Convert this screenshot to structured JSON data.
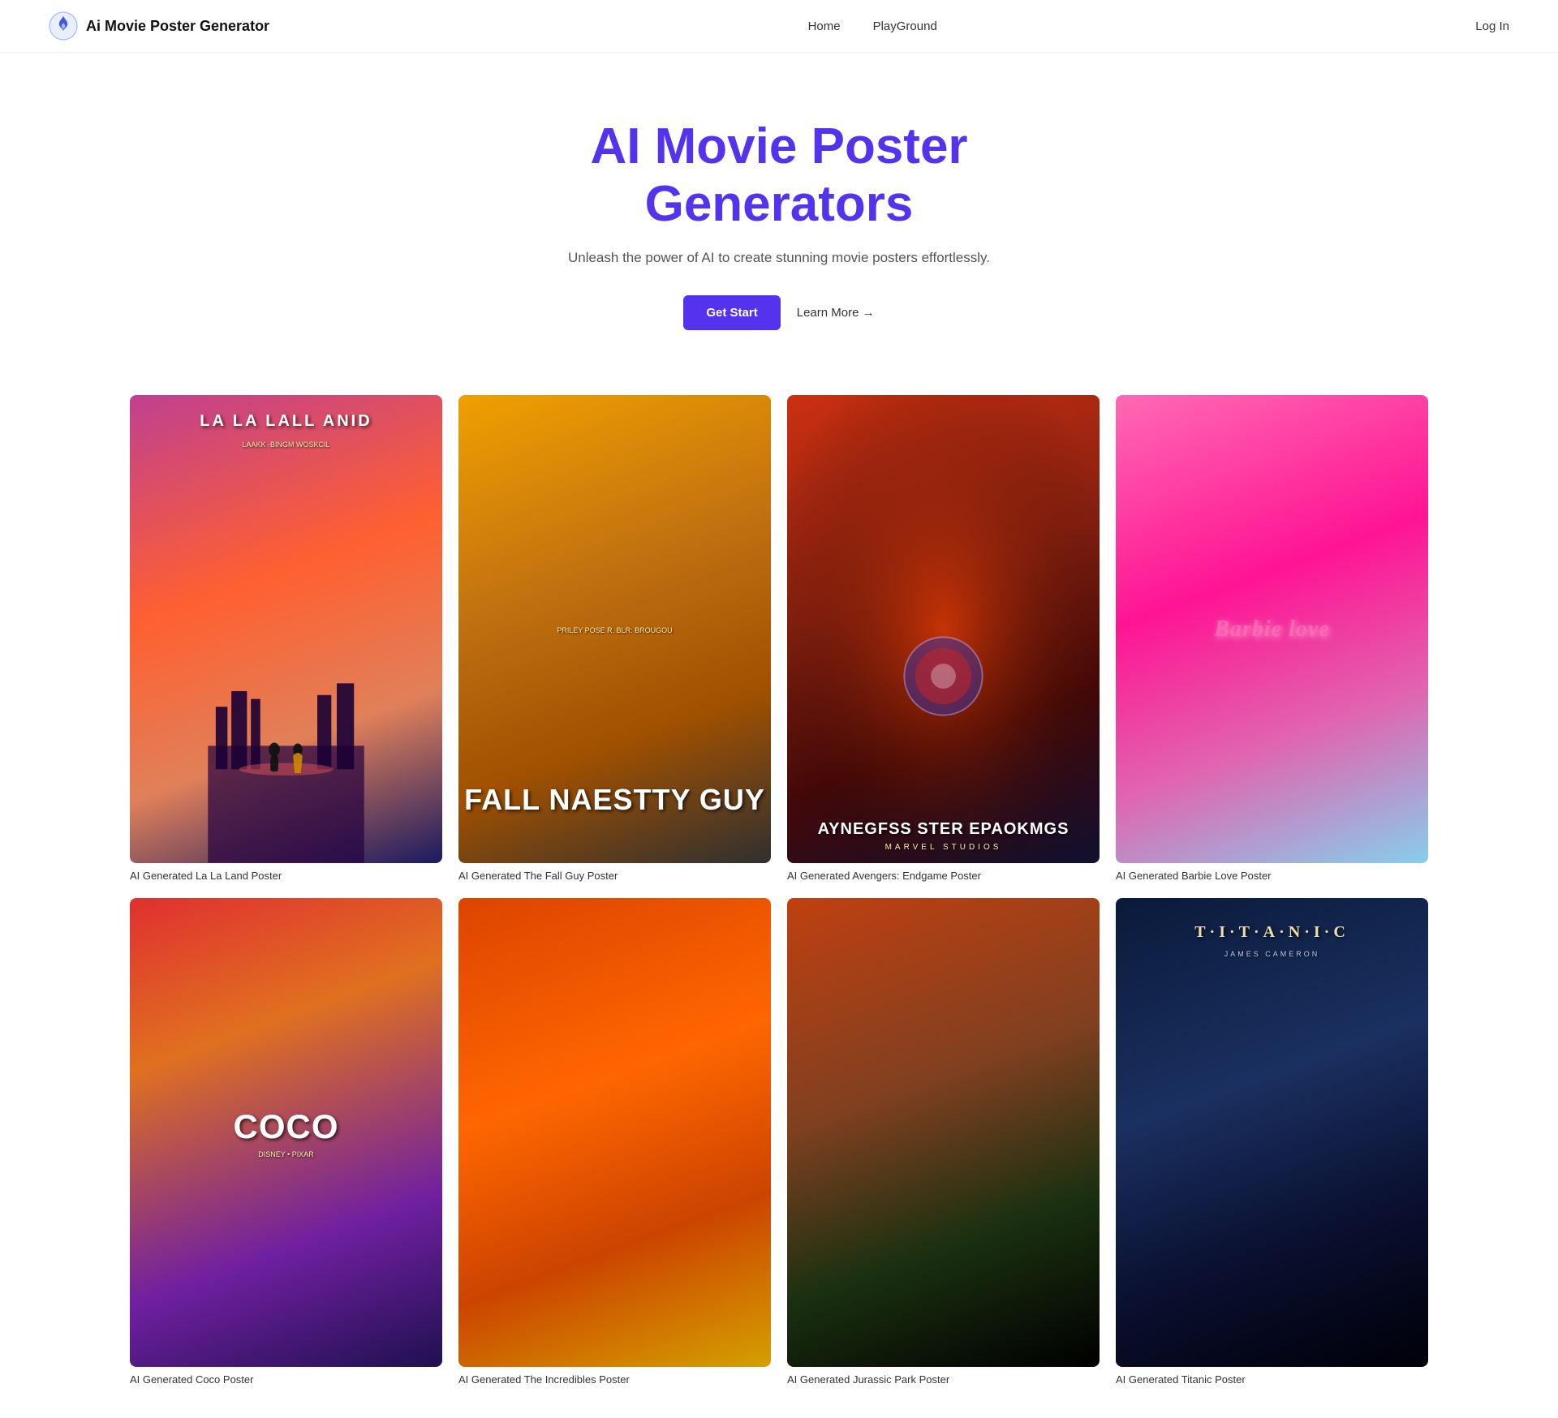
{
  "brand": {
    "name": "Ai Movie Poster Generator",
    "logo_alt": "flame-icon"
  },
  "nav": {
    "home": "Home",
    "playground": "PlayGround",
    "login": "Log In"
  },
  "hero": {
    "title_line1": "AI Movie Poster",
    "title_line2": "Generators",
    "subtitle": "Unleash the power of AI to create stunning movie posters effortlessly.",
    "cta_primary": "Get Start",
    "cta_secondary": "Learn More →"
  },
  "gallery": {
    "rows": [
      [
        {
          "id": "lalaland",
          "label": "AI Generated La La Land Poster",
          "title": "LA LA  LALL ANID",
          "subtitle": "LAAKK -BINGM WOSKCIL",
          "class": "poster-lalaland"
        },
        {
          "id": "fallguy",
          "label": "AI Generated The Fall Guy Poster",
          "title": "FALL\nNAESTTY\nGUY",
          "subtitle": "PRILEY  POSE R. BLR: BROUGOU",
          "class": "poster-fallguy"
        },
        {
          "id": "avengers",
          "label": "AI Generated Avengers: Endgame Poster",
          "title": "AYNEGFSS\nSTER EPAOKMGS",
          "subtitle": "MARVEL STUDIOS",
          "class": "poster-avengers"
        },
        {
          "id": "barbie",
          "label": "AI Generated Barbie Love Poster",
          "title": "Barbie love",
          "subtitle": "",
          "class": "poster-barbie"
        }
      ],
      [
        {
          "id": "coco",
          "label": "AI Generated Coco Poster",
          "title": "COCO",
          "subtitle": "DISNEY • PIXAR",
          "class": "poster-coco"
        },
        {
          "id": "incredibles",
          "label": "AI Generated The Incredibles Poster",
          "title": "",
          "subtitle": "",
          "class": "poster-incredibles"
        },
        {
          "id": "jurassic",
          "label": "AI Generated Jurassic Park Poster",
          "title": "",
          "subtitle": "",
          "class": "poster-jurassic"
        },
        {
          "id": "titanic",
          "label": "AI Generated Titanic Poster",
          "title": "T·I·T·A·N·I·C",
          "subtitle": "JAMES CAMERON",
          "class": "poster-titanic"
        }
      ]
    ]
  }
}
